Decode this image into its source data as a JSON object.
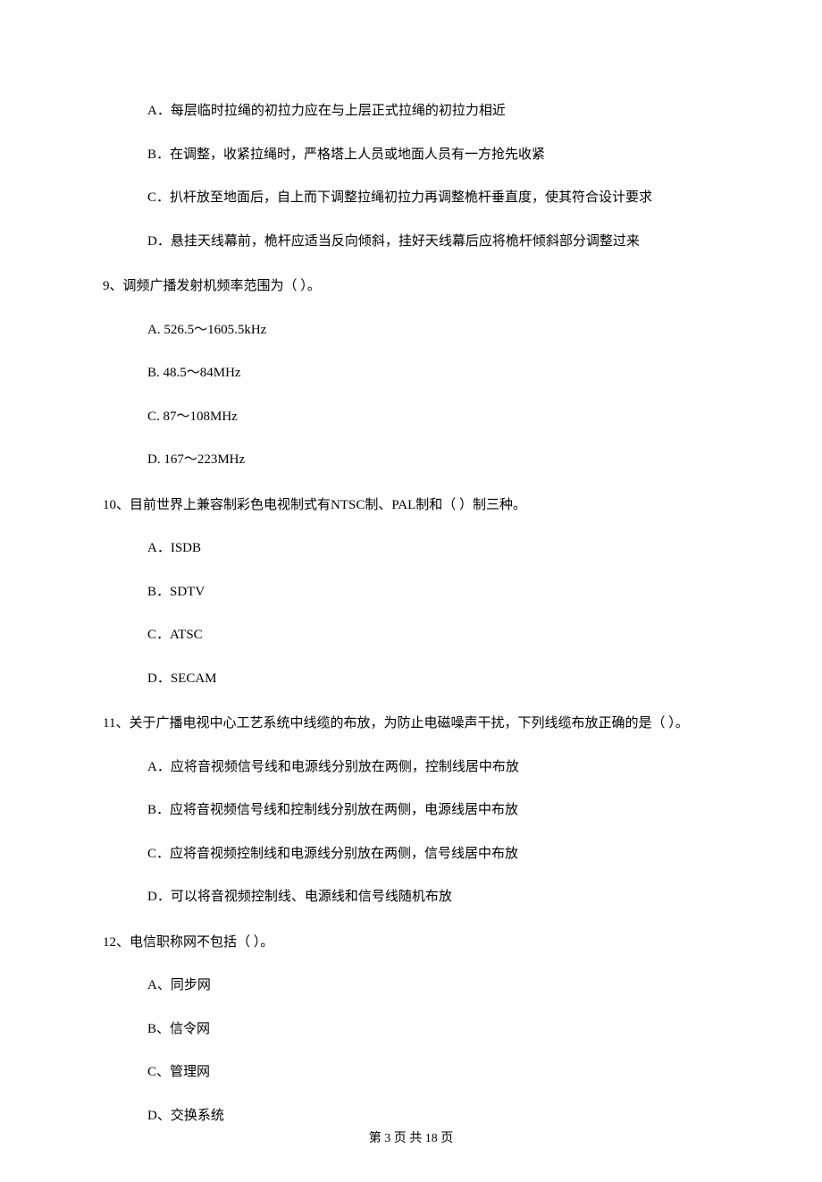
{
  "orphan_options": {
    "a": "A．每层临时拉绳的初拉力应在与上层正式拉绳的初拉力相近",
    "b": "B．在调整，收紧拉绳时，严格塔上人员或地面人员有一方抢先收紧",
    "c": "C．扒杆放至地面后，自上而下调整拉绳初拉力再调整桅杆垂直度，使其符合设计要求",
    "d": "D．悬挂天线幕前，桅杆应适当反向倾斜，挂好天线幕后应将桅杆倾斜部分调整过来"
  },
  "questions": [
    {
      "stem": "9、调频广播发射机频率范围为（    ）。",
      "opts": {
        "a": "A.  526.5～1605.5kHz",
        "b": "B.  48.5～84MHz",
        "c": "C.  87～108MHz",
        "d": "D.  167～223MHz"
      }
    },
    {
      "stem": "10、目前世界上兼容制彩色电视制式有NTSC制、PAL制和（    ）制三种。",
      "opts": {
        "a": "A．ISDB",
        "b": "B．SDTV",
        "c": "C．ATSC",
        "d": "D．SECAM"
      }
    },
    {
      "stem": "11、关于广播电视中心工艺系统中线缆的布放，为防止电磁噪声干扰，下列线缆布放正确的是（    ）。",
      "opts": {
        "a": "A．应将音视频信号线和电源线分别放在两侧，控制线居中布放",
        "b": "B．应将音视频信号线和控制线分别放在两侧，电源线居中布放",
        "c": "C．应将音视频控制线和电源线分别放在两侧，信号线居中布放",
        "d": "D．可以将音视频控制线、电源线和信号线随机布放"
      }
    },
    {
      "stem": "12、电信职称网不包括（    ）。",
      "opts": {
        "a": "A、同步网",
        "b": "B、信令网",
        "c": "C、管理网",
        "d": "D、交换系统"
      }
    }
  ],
  "footer": "第 3 页 共 18 页"
}
